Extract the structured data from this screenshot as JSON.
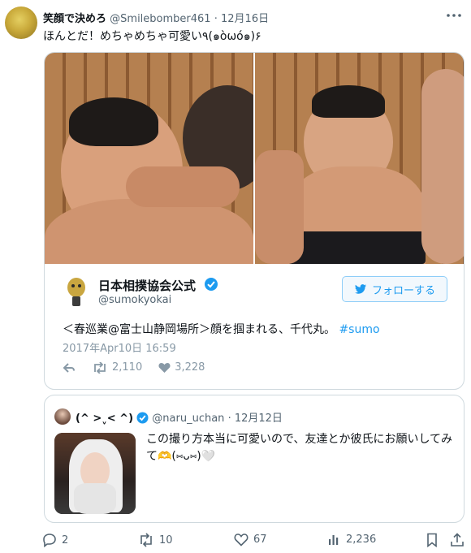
{
  "tweet": {
    "display_name": "笑顔で決めろ",
    "handle": "@Smilebomber461",
    "separator": "·",
    "date": "12月16日",
    "text": "ほんとだ！めちゃめちゃ可愛い٩(๑òωó๑)۶"
  },
  "embed": {
    "org_name": "日本相撲協会公式",
    "org_handle": "@sumokyokai",
    "follow_label": "フォローする",
    "text_main": "＜春巡業@富士山静岡場所＞顔を掴まれる、千代丸。",
    "hashtag": "#sumo",
    "timestamp": "2017年Apr10日 16:59",
    "retweets": "2,110",
    "likes": "3,228"
  },
  "quote": {
    "display_name": "(^ >ˬ< ^)",
    "handle": "@naru_uchan",
    "separator": "·",
    "date": "12月12日",
    "text": "この撮り方本当に可愛いので、友達とか彼氏にお願いしてみて🫶(⑅ᴗ⑅)🤍"
  },
  "actions": {
    "replies": "2",
    "reposts": "10",
    "likes": "67",
    "views": "2,236"
  },
  "colors": {
    "accent": "#1d9bf0",
    "muted": "#536471",
    "border": "#cfd9de"
  },
  "icons": [
    "more-icon",
    "verified-icon",
    "twitter-bird-icon",
    "reply-icon",
    "retweet-icon",
    "heart-icon",
    "views-icon",
    "bookmark-icon",
    "share-icon"
  ]
}
